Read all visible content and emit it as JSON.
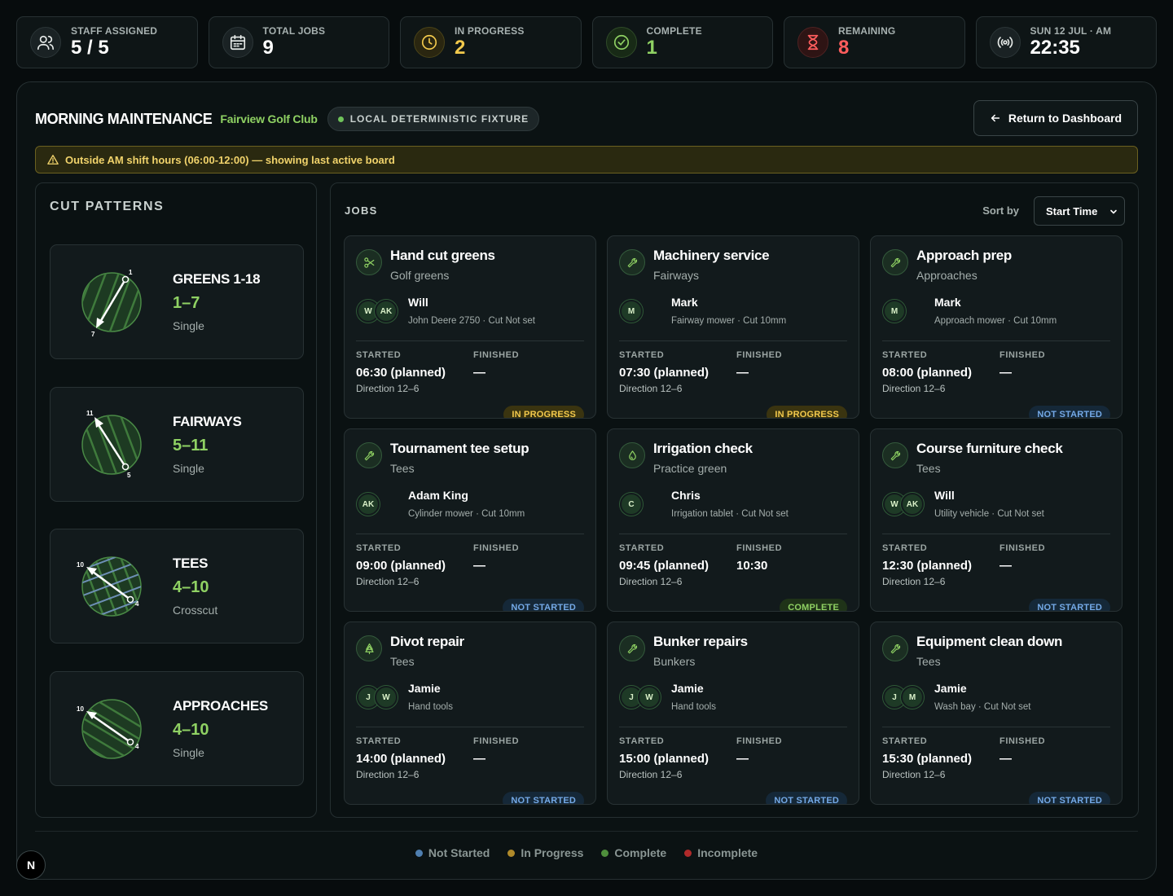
{
  "stats": [
    {
      "label": "STAFF ASSIGNED",
      "value": "5 / 5",
      "icon": "users-icon",
      "color": "#ffffff"
    },
    {
      "label": "TOTAL JOBS",
      "value": "9",
      "icon": "calendar-icon",
      "color": "#ffffff"
    },
    {
      "label": "IN PROGRESS",
      "value": "2",
      "icon": "clock-icon",
      "color": "#f2c94c"
    },
    {
      "label": "COMPLETE",
      "value": "1",
      "icon": "check-circle-icon",
      "color": "#8fd163"
    },
    {
      "label": "REMAINING",
      "value": "8",
      "icon": "hourglass-icon",
      "color": "#ff5d5d"
    },
    {
      "label": "SUN 12 JUL · AM",
      "value": "22:35",
      "icon": "broadcast-icon",
      "color": "#ffffff"
    }
  ],
  "header": {
    "title": "MORNING MAINTENANCE",
    "club": "Fairview Golf Club",
    "fixture": "LOCAL DETERMINISTIC FIXTURE",
    "back_label": "Return to Dashboard"
  },
  "warning": "Outside AM shift hours (06:00-12:00) — showing last active board",
  "patterns": {
    "title": "CUT PATTERNS",
    "items": [
      {
        "name": "GREENS 1-18",
        "direction": "1–7",
        "type": "Single",
        "from": "1",
        "to": "7"
      },
      {
        "name": "FAIRWAYS",
        "direction": "5–11",
        "type": "Single",
        "from": "5",
        "to": "11"
      },
      {
        "name": "TEES",
        "direction": "4–10",
        "type": "Crosscut",
        "from": "4",
        "to": "10"
      },
      {
        "name": "APPROACHES",
        "direction": "4–10",
        "type": "Single",
        "from": "4",
        "to": "10"
      }
    ]
  },
  "jobs": {
    "title": "JOBS",
    "sort_label": "Sort by",
    "sort_value": "Start Time",
    "started_label": "STARTED",
    "finished_label": "FINISHED",
    "items": [
      {
        "title": "Hand cut greens",
        "area": "Golf greens",
        "icon": "scissors-icon",
        "avatars": [
          "W",
          "AK"
        ],
        "person": "Will",
        "equipment": "John Deere 2750 · Cut Not set",
        "started": "06:30 (planned)",
        "finished": "—",
        "direction": "Direction 12–6",
        "status": "IN PROGRESS",
        "status_class": "st-progress"
      },
      {
        "title": "Machinery service",
        "area": "Fairways",
        "icon": "wrench-icon",
        "avatars": [
          "M"
        ],
        "person": "Mark",
        "equipment": "Fairway mower · Cut 10mm",
        "started": "07:30 (planned)",
        "finished": "—",
        "direction": "Direction 12–6",
        "status": "IN PROGRESS",
        "status_class": "st-progress"
      },
      {
        "title": "Approach prep",
        "area": "Approaches",
        "icon": "wrench-icon",
        "avatars": [
          "M"
        ],
        "person": "Mark",
        "equipment": "Approach mower · Cut 10mm",
        "started": "08:00 (planned)",
        "finished": "—",
        "direction": "Direction 12–6",
        "status": "NOT STARTED",
        "status_class": "st-notstarted"
      },
      {
        "title": "Tournament tee setup",
        "area": "Tees",
        "icon": "wrench-icon",
        "avatars": [
          "AK"
        ],
        "person": "Adam King",
        "equipment": "Cylinder mower · Cut 10mm",
        "started": "09:00 (planned)",
        "finished": "—",
        "direction": "Direction 12–6",
        "status": "NOT STARTED",
        "status_class": "st-notstarted"
      },
      {
        "title": "Irrigation check",
        "area": "Practice green",
        "icon": "droplet-icon",
        "avatars": [
          "C"
        ],
        "person": "Chris",
        "equipment": "Irrigation tablet · Cut Not set",
        "started": "09:45 (planned)",
        "finished": "10:30",
        "direction": "Direction 12–6",
        "status": "COMPLETE",
        "status_class": "st-complete"
      },
      {
        "title": "Course furniture check",
        "area": "Tees",
        "icon": "wrench-icon",
        "avatars": [
          "W",
          "AK"
        ],
        "person": "Will",
        "equipment": "Utility vehicle · Cut Not set",
        "started": "12:30 (planned)",
        "finished": "—",
        "direction": "Direction 12–6",
        "status": "NOT STARTED",
        "status_class": "st-notstarted"
      },
      {
        "title": "Divot repair",
        "area": "Tees",
        "icon": "tree-icon",
        "avatars": [
          "J",
          "W"
        ],
        "person": "Jamie",
        "equipment": "Hand tools",
        "started": "14:00 (planned)",
        "finished": "—",
        "direction": "Direction 12–6",
        "status": "NOT STARTED",
        "status_class": "st-notstarted"
      },
      {
        "title": "Bunker repairs",
        "area": "Bunkers",
        "icon": "wrench-icon",
        "avatars": [
          "J",
          "W"
        ],
        "person": "Jamie",
        "equipment": "Hand tools",
        "started": "15:00 (planned)",
        "finished": "—",
        "direction": "Direction 12–6",
        "status": "NOT STARTED",
        "status_class": "st-notstarted"
      },
      {
        "title": "Equipment clean down",
        "area": "Tees",
        "icon": "wrench-icon",
        "avatars": [
          "J",
          "M"
        ],
        "person": "Jamie",
        "equipment": "Wash bay · Cut Not set",
        "started": "15:30 (planned)",
        "finished": "—",
        "direction": "Direction 12–6",
        "status": "NOT STARTED",
        "status_class": "st-notstarted"
      }
    ]
  },
  "legend": [
    {
      "label": "Not Started",
      "color": "#4f7fb0"
    },
    {
      "label": "In Progress",
      "color": "#b08a2a"
    },
    {
      "label": "Complete",
      "color": "#4f8f3c"
    },
    {
      "label": "Incomplete",
      "color": "#b02a2a"
    }
  ],
  "badge": "N"
}
